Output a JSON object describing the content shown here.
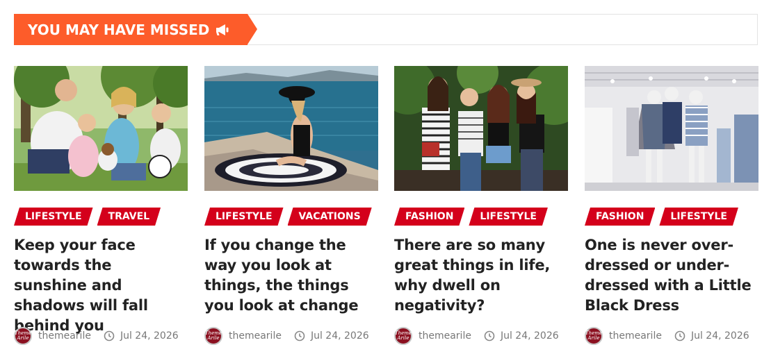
{
  "section": {
    "title": "YOU MAY HAVE MISSED",
    "icon": "megaphone-icon"
  },
  "colors": {
    "header_accent": "#fd5c2a",
    "category_badge": "#d4001b",
    "title_text": "#222222",
    "meta_text": "#777777"
  },
  "posts": [
    {
      "image": "family-in-park-photo",
      "categories": [
        "LIFESTYLE",
        "TRAVEL"
      ],
      "title": "Keep your face towards the sunshine and shadows will fall behind you",
      "author": "themearile",
      "date": "Jul 24, 2026"
    },
    {
      "image": "woman-by-sea-photo",
      "categories": [
        "LIFESTYLE",
        "VACATIONS"
      ],
      "title": "If you change the way you look at things, the things you look at change",
      "author": "themearile",
      "date": "Jul 24, 2026"
    },
    {
      "image": "four-friends-laughing-photo",
      "categories": [
        "FASHION",
        "LIFESTYLE"
      ],
      "title": "There are so many great things in life, why dwell on negativity?",
      "author": "themearile",
      "date": "Jul 24, 2026"
    },
    {
      "image": "clothing-store-mannequins-photo",
      "categories": [
        "FASHION",
        "LIFESTYLE"
      ],
      "title": "One is never over-dressed or under-dressed with a Little Black Dress",
      "author": "themearile",
      "date": "Jul 24, 2026"
    }
  ],
  "avatar_logo": "Theme Arile"
}
